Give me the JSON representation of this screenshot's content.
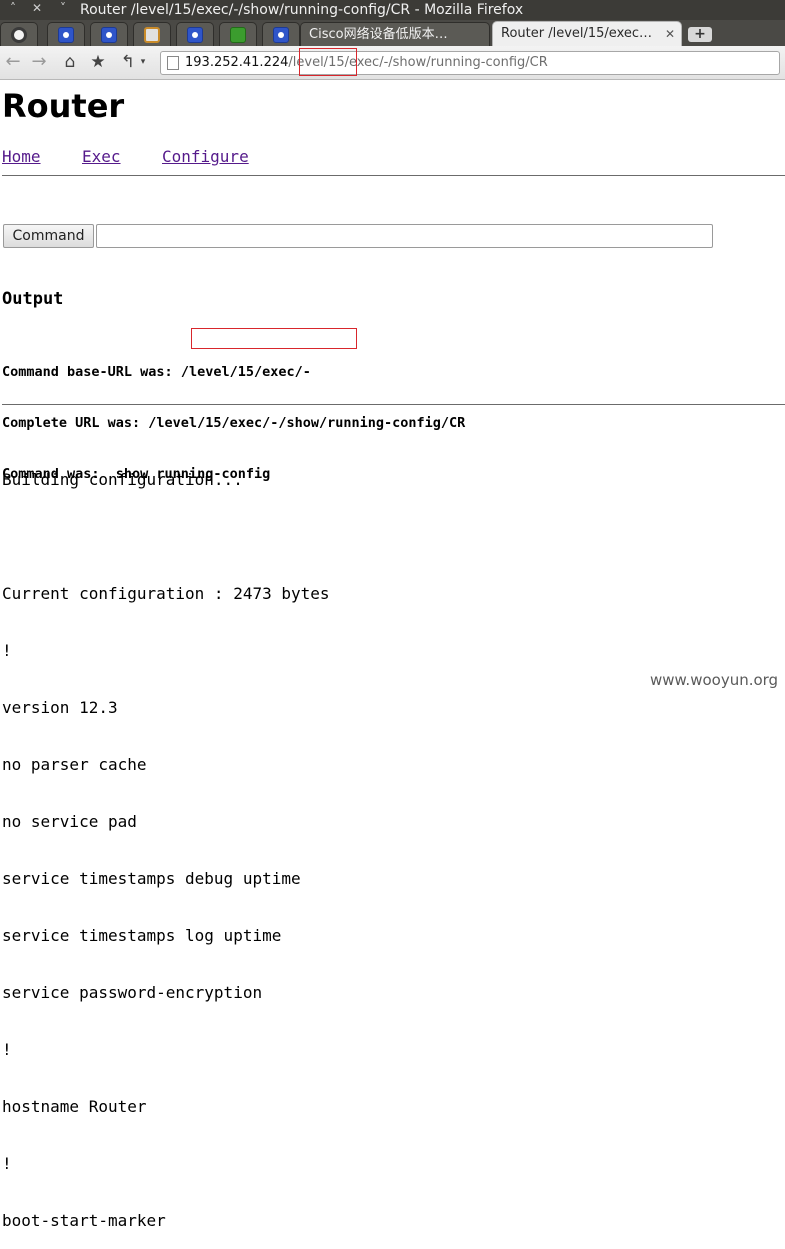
{
  "window": {
    "title": "Router /level/15/exec/-/show/running-config/CR - Mozilla Firefox",
    "controls": [
      "˄",
      "✕",
      "˅"
    ]
  },
  "tabs": {
    "small_tab_icons": [
      "ubuntu-icon",
      "paw-icon",
      "paw-icon",
      "ring-icon",
      "paw-icon",
      "green-icon",
      "paw-icon"
    ],
    "cisco_label": "Cisco网络设备低版本…",
    "active_label": "Router /level/15/exec…",
    "close_glyph": "✕",
    "new_tab_glyph": "+"
  },
  "navbar": {
    "back_glyph": "←",
    "forward_glyph": "→",
    "home_glyph": "⌂",
    "star_glyph": "★",
    "history_glyph": "↰",
    "dropdown_glyph": "▾",
    "url_host": "193.252.41.224",
    "url_path": "/level/15/exec/-/show/running-config/CR"
  },
  "page": {
    "title": "Router",
    "links": [
      "Home",
      "Exec",
      "Configure"
    ],
    "command_button": "Command",
    "command_value": "",
    "output_heading": "Output",
    "info": {
      "base_prefix": "Command base-URL was: ",
      "base_value": "/level/15/exec/-",
      "complete_url": "Complete URL was: /level/15/exec/-/show/running-config/CR",
      "command_was": "Command was:  show running-config"
    },
    "config_lines": [
      "Building configuration...",
      "",
      "Current configuration : 2473 bytes",
      "!",
      "version 12.3",
      "no parser cache",
      "no service pad",
      "service timestamps debug uptime",
      "service timestamps log uptime",
      "service password-encryption",
      "!",
      "hostname Router",
      "!",
      "boot-start-marker"
    ]
  },
  "watermark": "www.wooyun.org",
  "colors": {
    "link": "#551a8b",
    "highlight_box": "#d8262c",
    "titlebar": "#3c3b37"
  }
}
